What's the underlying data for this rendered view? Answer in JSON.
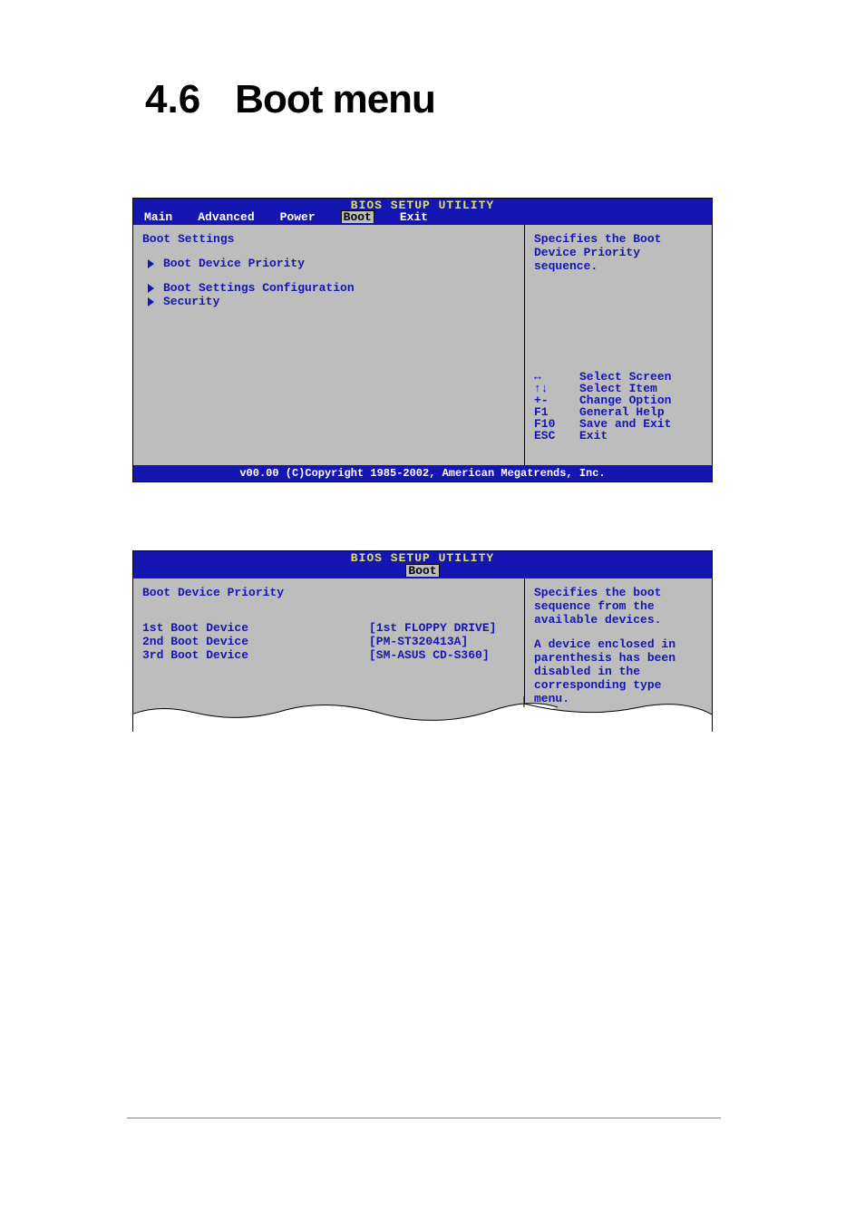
{
  "page": {
    "section_number": "4.6",
    "title": "Boot menu"
  },
  "bios1": {
    "title": "BIOS SETUP UTILITY",
    "tabs": {
      "main": "Main",
      "advanced": "Advanced",
      "power": "Power",
      "boot": "Boot",
      "exit": "Exit"
    },
    "heading": "Boot Settings",
    "items": {
      "i0": "Boot Device Priority",
      "i1": "Boot Settings Configuration",
      "i2": "Security"
    },
    "help": "Specifies the Boot Device Priority sequence.",
    "keys": {
      "k0": {
        "sym": "↔",
        "desc": "Select Screen"
      },
      "k1": {
        "sym": "↑↓",
        "desc": "Select Item"
      },
      "k2": {
        "sym": "+-",
        "desc": "Change Option"
      },
      "k3": {
        "sym": "F1",
        "desc": "General Help"
      },
      "k4": {
        "sym": "F10",
        "desc": "Save and Exit"
      },
      "k5": {
        "sym": "ESC",
        "desc": "Exit"
      }
    },
    "footer": "v00.00 (C)Copyright 1985-2002, American Megatrends, Inc."
  },
  "bios2": {
    "title": "BIOS SETUP UTILITY",
    "tab": "Boot",
    "heading": "Boot Device Priority",
    "devices": {
      "d0": {
        "label": "1st Boot Device",
        "value": "[1st FLOPPY DRIVE]"
      },
      "d1": {
        "label": "2nd Boot Device",
        "value": "[PM-ST320413A]"
      },
      "d2": {
        "label": "3rd Boot Device",
        "value": "[SM-ASUS CD-S360]"
      }
    },
    "help1": "Specifies the boot sequence from the available devices.",
    "help2": "A device enclosed in parenthesis has been disabled in the corresponding type menu."
  }
}
